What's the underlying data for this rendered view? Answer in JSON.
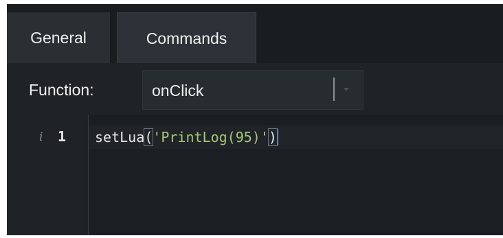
{
  "tabs": {
    "general_label": "General",
    "commands_label": "Commands",
    "active": "Commands"
  },
  "function": {
    "label": "Function:",
    "selected_value": "onClick"
  },
  "editor": {
    "info_marker": "i",
    "line_number": "1",
    "code": {
      "function_name": "setLua",
      "open_paren": "(",
      "string_literal": "'PrintLog(95)'",
      "close_paren": ")"
    }
  },
  "colors": {
    "panel_background": "#1f2327",
    "string_color": "#a8c776",
    "cursor_color": "#4aa3ff",
    "text_color": "#f0f0f0"
  }
}
